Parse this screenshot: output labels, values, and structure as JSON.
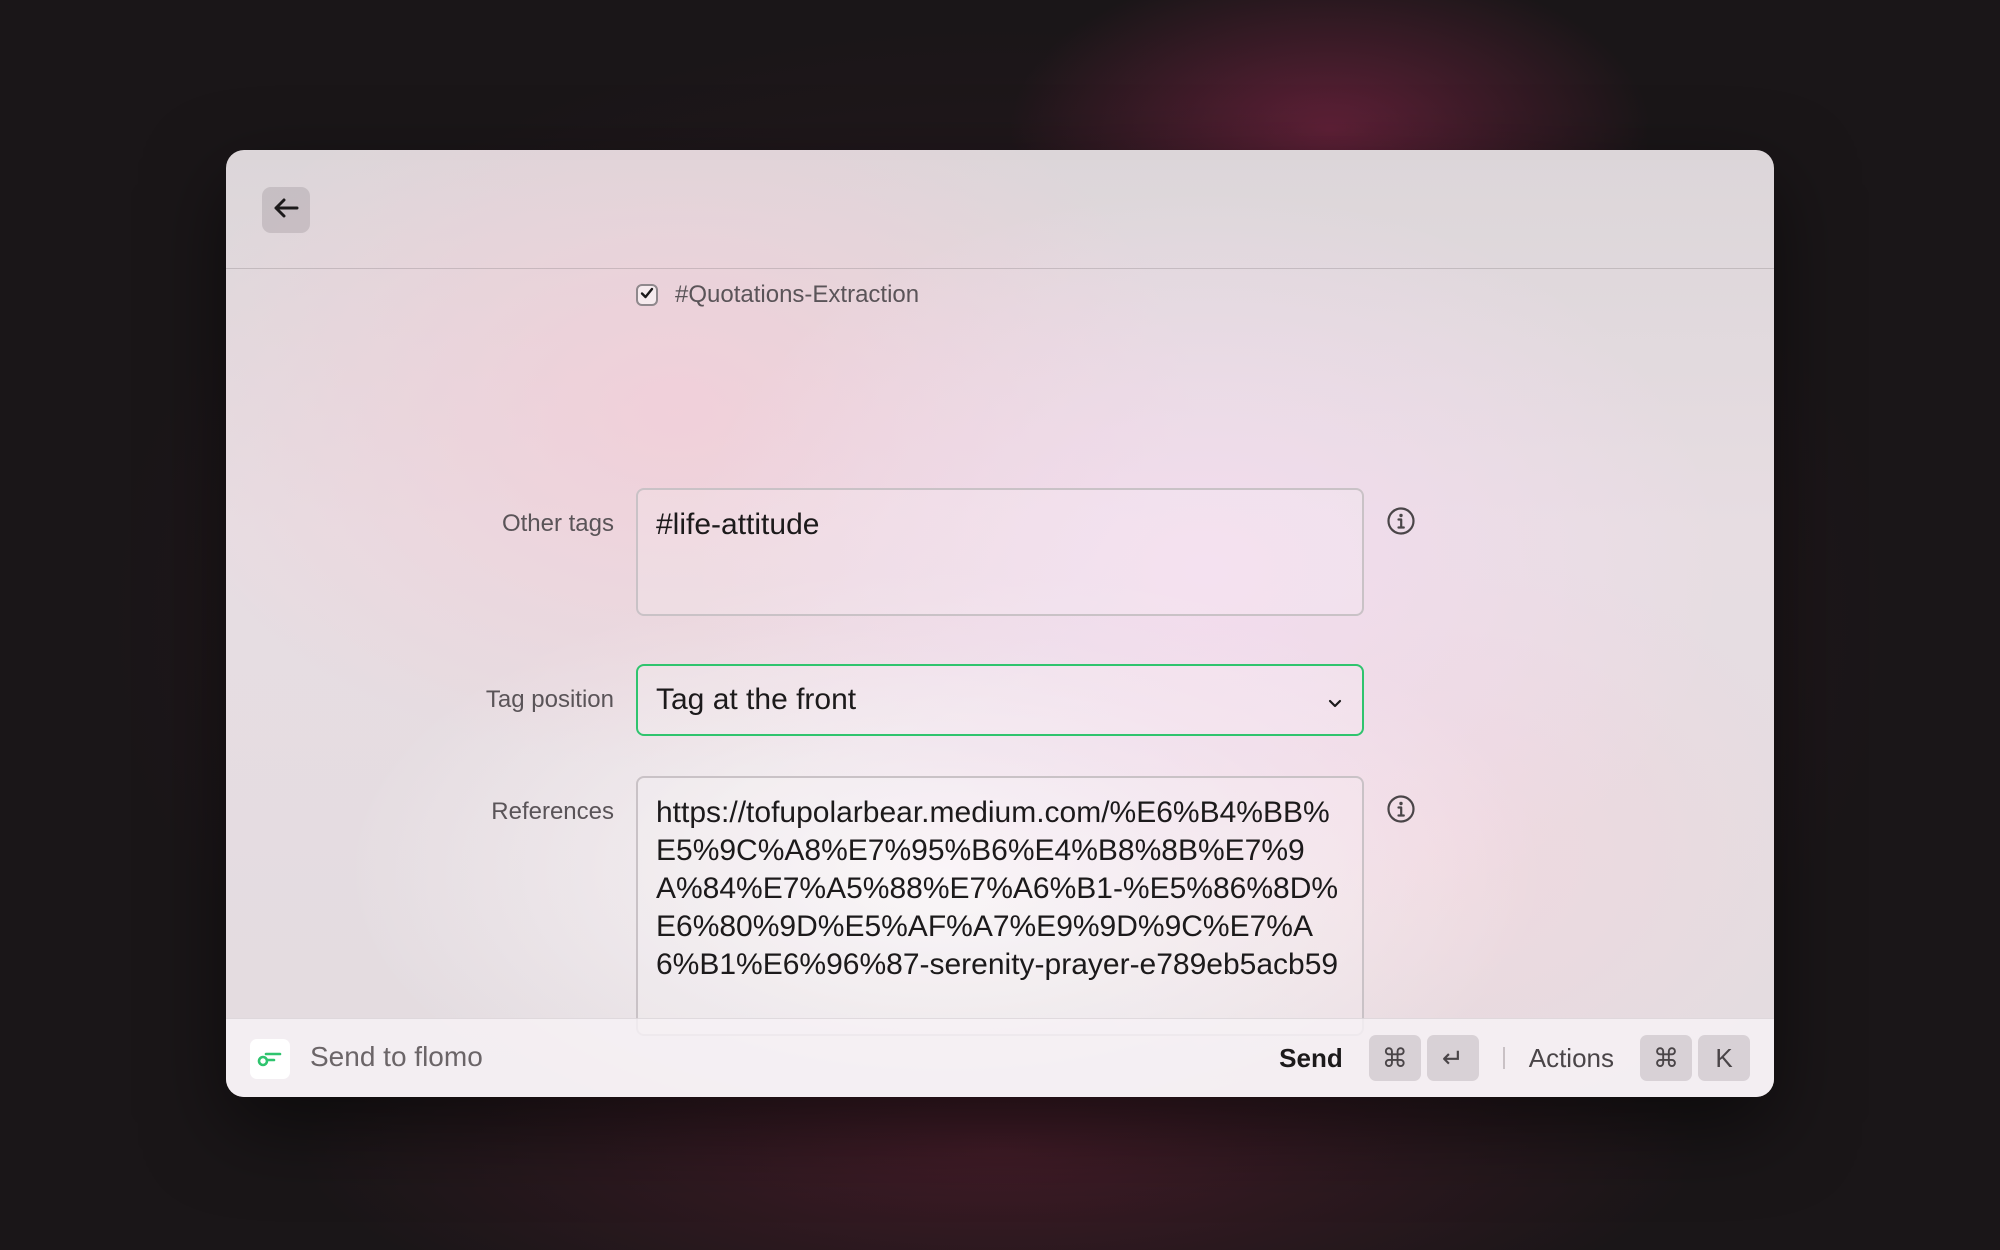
{
  "header": {
    "back_icon": "arrow-left-icon"
  },
  "form": {
    "checkbox": {
      "label": "#Quotations-Extraction",
      "checked": true
    },
    "other_tags": {
      "label": "Other tags",
      "value": "#life-attitude"
    },
    "tag_position": {
      "label": "Tag position",
      "value": "Tag at the front"
    },
    "references": {
      "label": "References",
      "value": "https://tofupolarbear.medium.com/%E6%B4%BB%E5%9C%A8%E7%95%B6%E4%B8%8B%E7%9A%84%E7%A5%88%E7%A6%B1-%E5%86%8D%E6%80%9D%E5%AF%A7%E9%9D%9C%E7%A6%B1%E6%96%87-serenity-prayer-e789eb5acb59"
    }
  },
  "footer": {
    "title": "Send to flomo",
    "primary_action": "Send",
    "primary_keys": [
      "⌘",
      "↵"
    ],
    "secondary_action": "Actions",
    "secondary_keys": [
      "⌘",
      "K"
    ]
  },
  "colors": {
    "accent": "#2fc46e"
  }
}
